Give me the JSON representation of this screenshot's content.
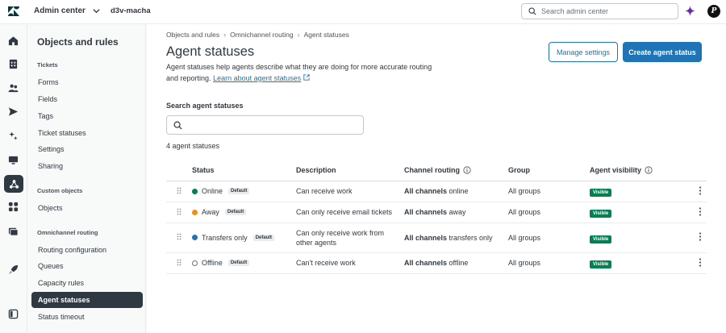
{
  "topbar": {
    "product": "Admin center",
    "instance": "d3v-macha",
    "search_placeholder": "Search admin center",
    "avatar_initial": "P"
  },
  "sidenav": {
    "title": "Objects and rules",
    "sections": [
      {
        "label": "Tickets",
        "items": [
          "Forms",
          "Fields",
          "Tags",
          "Ticket statuses",
          "Settings",
          "Sharing"
        ]
      },
      {
        "label": "Custom objects",
        "items": [
          "Objects"
        ]
      },
      {
        "label": "Omnichannel routing",
        "items": [
          "Routing configuration",
          "Queues",
          "Capacity rules",
          "Agent statuses",
          "Status timeout"
        ]
      }
    ],
    "active_item": "Agent statuses"
  },
  "breadcrumb": [
    "Objects and rules",
    "Omnichannel routing",
    "Agent statuses"
  ],
  "page": {
    "title": "Agent statuses",
    "description": "Agent statuses help agents describe what they are doing for more accurate routing and reporting.",
    "learn_more": "Learn about agent statuses",
    "manage_settings": "Manage settings",
    "create_status": "Create agent status",
    "search_label": "Search agent statuses",
    "count_text": "4 agent statuses"
  },
  "table": {
    "columns": [
      "Status",
      "Description",
      "Channel routing",
      "Group",
      "Agent visibility"
    ],
    "rows": [
      {
        "status": "Online",
        "color": "#038153",
        "dot": "filled",
        "default": "Default",
        "description": "Can receive work",
        "routing_bold": "All channels",
        "routing_rest": "online",
        "group": "All groups",
        "visibility": "Visible"
      },
      {
        "status": "Away",
        "color": "#ed8f1c",
        "dot": "filled",
        "default": "Default",
        "description": "Can only receive email tickets",
        "routing_bold": "All channels",
        "routing_rest": "away",
        "group": "All groups",
        "visibility": "Visible"
      },
      {
        "status": "Transfers only",
        "color": "#1f73b7",
        "dot": "filled",
        "default": "Default",
        "description": "Can only receive work from other agents",
        "routing_bold": "All channels",
        "routing_rest": "transfers only",
        "group": "All groups",
        "visibility": "Visible"
      },
      {
        "status": "Offline",
        "color": "#68737d",
        "dot": "outline",
        "default": "Default",
        "description": "Can't receive work",
        "routing_bold": "All channels",
        "routing_rest": "offline",
        "group": "All groups",
        "visibility": "Visible"
      }
    ]
  }
}
